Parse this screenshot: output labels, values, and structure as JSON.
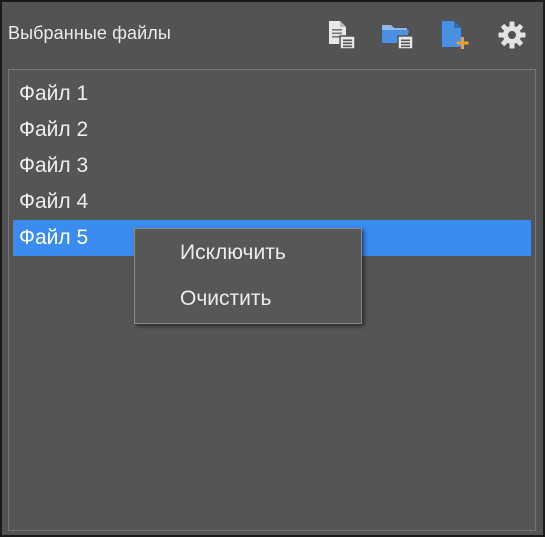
{
  "panel": {
    "title": "Выбранные файлы",
    "toolbar": [
      {
        "icon": "file-list-icon",
        "name": "file-list-button"
      },
      {
        "icon": "folder-list-icon",
        "name": "folder-list-button"
      },
      {
        "icon": "add-file-icon",
        "name": "add-file-button"
      },
      {
        "icon": "gear-icon",
        "name": "settings-button"
      }
    ]
  },
  "files": [
    {
      "label": "Файл 1"
    },
    {
      "label": "Файл 2"
    },
    {
      "label": "Файл 3"
    },
    {
      "label": "Файл 4"
    },
    {
      "label": "Файл 5",
      "selected": true
    }
  ],
  "context_menu": {
    "items": [
      {
        "label": "Исключить"
      },
      {
        "label": "Очистить"
      }
    ]
  },
  "colors": {
    "background": "#535353",
    "selection": "#3b8cf0",
    "icon_blue": "#4a90e2",
    "icon_orange": "#f29b38",
    "icon_light": "#e8e8e8"
  }
}
